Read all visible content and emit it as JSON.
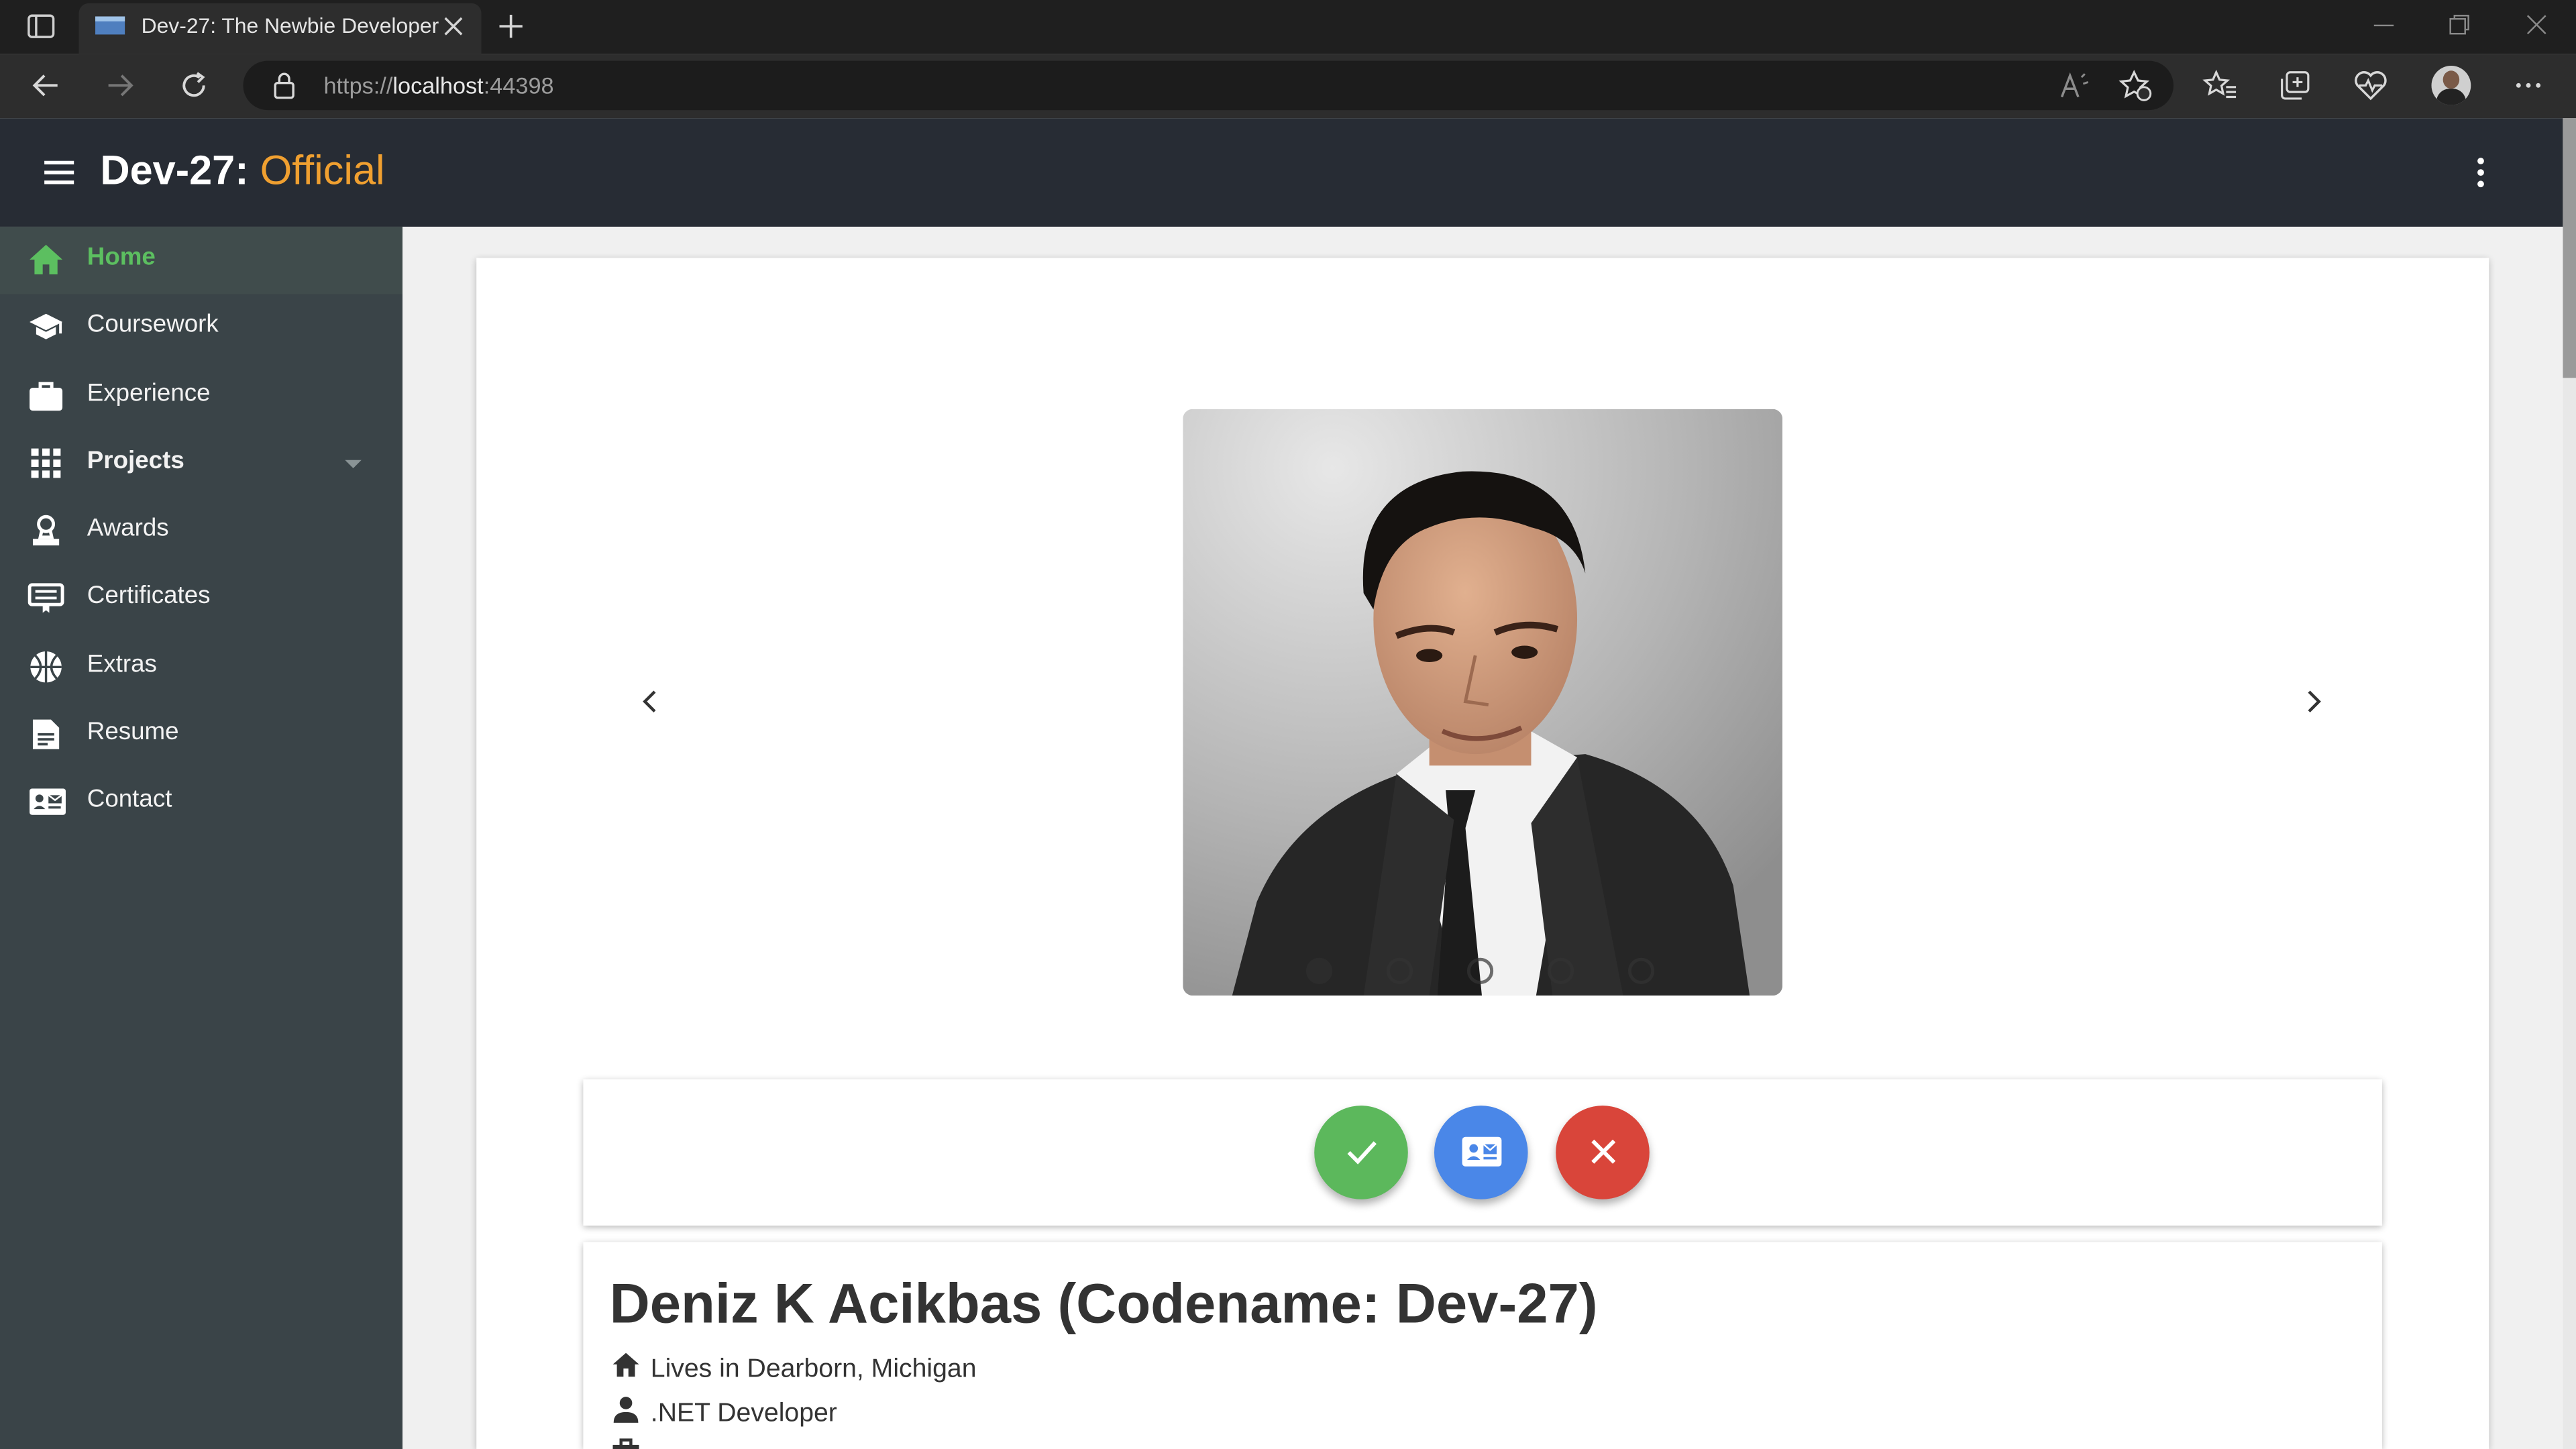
{
  "browser": {
    "tab_title": "Dev-27: The Newbie Developer",
    "url_scheme": "https://",
    "url_host": "localhost",
    "url_port": ":44398"
  },
  "app": {
    "title_main": "Dev-27:",
    "title_accent": "Official"
  },
  "colors": {
    "accent": "#f0a030",
    "active_nav": "#5cbf60",
    "appbar": "#272c34",
    "sidebar": "#3a4448",
    "confirm_button": "#5cb85c",
    "contact_button": "#4a87e8",
    "close_button": "#d9453a"
  },
  "sidebar": {
    "items": [
      {
        "label": "Home",
        "icon": "home-icon",
        "active": true
      },
      {
        "label": "Coursework",
        "icon": "school-icon"
      },
      {
        "label": "Experience",
        "icon": "briefcase-icon"
      },
      {
        "label": "Projects",
        "icon": "apps-grid-icon",
        "expandable": true
      },
      {
        "label": "Awards",
        "icon": "award-icon"
      },
      {
        "label": "Certificates",
        "icon": "certificate-icon"
      },
      {
        "label": "Extras",
        "icon": "sports-ball-icon"
      },
      {
        "label": "Resume",
        "icon": "document-icon"
      },
      {
        "label": "Contact",
        "icon": "contact-card-icon"
      }
    ]
  },
  "carousel": {
    "slide_count": 5,
    "active_index": 0
  },
  "actions": {
    "confirm_icon": "check-icon",
    "contact_icon": "contact-card-icon",
    "close_icon": "close-icon"
  },
  "profile": {
    "name": "Deniz K Acikbas (Codename: Dev-27)",
    "location": "Lives in Dearborn, Michigan",
    "role": ".NET Developer"
  }
}
